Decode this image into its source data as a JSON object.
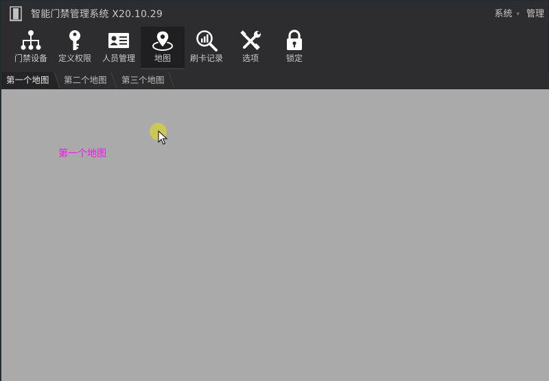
{
  "window": {
    "title": "智能门禁管理系统 X20.10.29",
    "menu": [
      {
        "label": "系统"
      },
      {
        "label": "管理"
      }
    ]
  },
  "toolbar": [
    {
      "label": "门禁设备",
      "icon": "org-tree-icon",
      "active": false
    },
    {
      "label": "定义权限",
      "icon": "key-icon",
      "active": false
    },
    {
      "label": "人员管理",
      "icon": "id-card-icon",
      "active": false
    },
    {
      "label": "地图",
      "icon": "map-pin-icon",
      "active": true
    },
    {
      "label": "刷卡记录",
      "icon": "search-chart-icon",
      "active": false
    },
    {
      "label": "选项",
      "icon": "tools-icon",
      "active": false
    },
    {
      "label": "锁定",
      "icon": "lock-icon",
      "active": false
    }
  ],
  "tabs": [
    {
      "label": "第一个地图",
      "active": true
    },
    {
      "label": "第二个地图",
      "active": false
    },
    {
      "label": "第三个地图",
      "active": false
    }
  ],
  "map": {
    "label": "第一个地图",
    "label_color": "#e61ee6",
    "background": "#a9aaa9"
  }
}
